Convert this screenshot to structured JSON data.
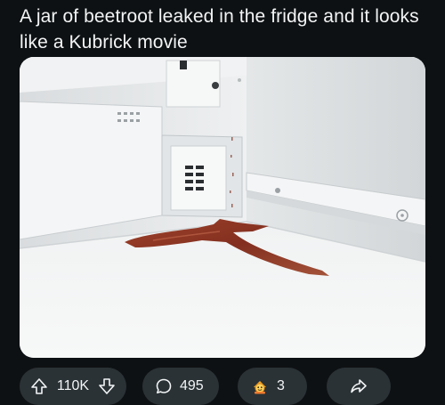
{
  "post": {
    "title": "A jar of beetroot leaked in the fridge and it looks like a Kubrick movie"
  },
  "actions": {
    "vote_count": "110K",
    "comment_count": "495",
    "award_count": "3"
  },
  "icons": {
    "upvote": "arrow-up-icon",
    "downvote": "arrow-down-icon",
    "comment": "speech-bubble-icon",
    "award": "award-icon",
    "share": "share-arrow-icon"
  },
  "colors": {
    "background": "#0e1113",
    "pill": "#2a3236",
    "text": "#f2f4f5",
    "spill": "#8a2a18"
  }
}
